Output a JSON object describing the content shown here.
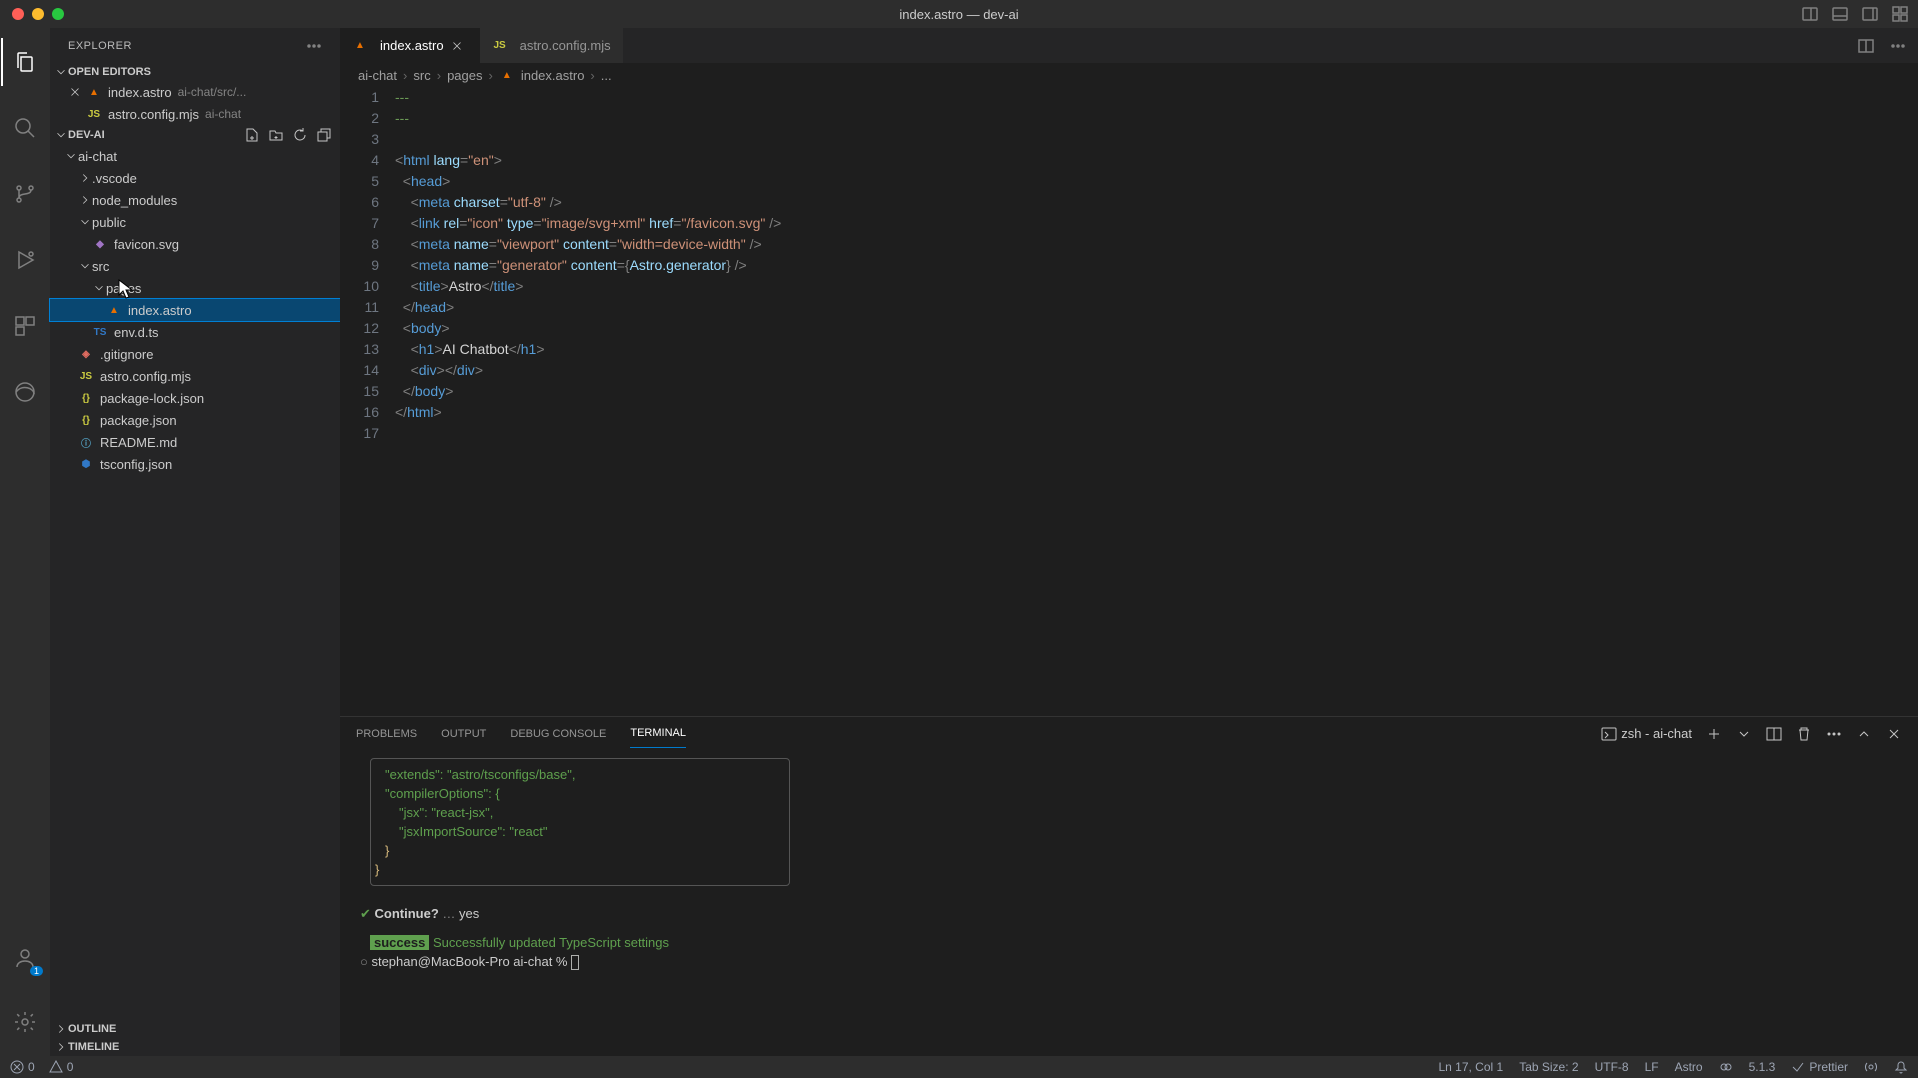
{
  "window": {
    "title": "index.astro — dev-ai"
  },
  "explorer": {
    "title": "EXPLORER",
    "openEditors": {
      "label": "OPEN EDITORS",
      "items": [
        {
          "name": "index.astro",
          "hint": "ai-chat/src/..."
        },
        {
          "name": "astro.config.mjs",
          "hint": "ai-chat"
        }
      ]
    },
    "workspace": {
      "name": "DEV-AI",
      "tree": {
        "aiChat": "ai-chat",
        "vscode": ".vscode",
        "nodeModules": "node_modules",
        "public": "public",
        "favicon": "favicon.svg",
        "src": "src",
        "pages": "pages",
        "indexAstro": "index.astro",
        "envDts": "env.d.ts",
        "gitignore": ".gitignore",
        "astroConfig": "astro.config.mjs",
        "packageLock": "package-lock.json",
        "packageJson": "package.json",
        "readme": "README.md",
        "tsconfig": "tsconfig.json"
      }
    },
    "outline": "OUTLINE",
    "timeline": "TIMELINE"
  },
  "tabs": [
    {
      "name": "index.astro",
      "active": true
    },
    {
      "name": "astro.config.mjs",
      "active": false
    }
  ],
  "breadcrumbs": [
    "ai-chat",
    "src",
    "pages",
    "index.astro",
    "..."
  ],
  "code": {
    "lines": [
      {
        "n": 1,
        "html": "<span class='tok-comment'>---</span>"
      },
      {
        "n": 2,
        "html": "<span class='tok-comment'>---</span>"
      },
      {
        "n": 3,
        "html": ""
      },
      {
        "n": 4,
        "html": "<span class='tok-punc'>&lt;</span><span class='tok-tag'>html</span> <span class='tok-attr'>lang</span><span class='tok-punc'>=</span><span class='tok-str'>\"en\"</span><span class='tok-punc'>&gt;</span>"
      },
      {
        "n": 5,
        "html": "  <span class='tok-punc'>&lt;</span><span class='tok-tag'>head</span><span class='tok-punc'>&gt;</span>"
      },
      {
        "n": 6,
        "html": "    <span class='tok-punc'>&lt;</span><span class='tok-tag'>meta</span> <span class='tok-attr'>charset</span><span class='tok-punc'>=</span><span class='tok-str'>\"utf-8\"</span> <span class='tok-punc'>/&gt;</span>"
      },
      {
        "n": 7,
        "html": "    <span class='tok-punc'>&lt;</span><span class='tok-tag'>link</span> <span class='tok-attr'>rel</span><span class='tok-punc'>=</span><span class='tok-str'>\"icon\"</span> <span class='tok-attr'>type</span><span class='tok-punc'>=</span><span class='tok-str'>\"image/svg+xml\"</span> <span class='tok-attr'>href</span><span class='tok-punc'>=</span><span class='tok-str'>\"/favicon.svg\"</span> <span class='tok-punc'>/&gt;</span>"
      },
      {
        "n": 8,
        "html": "    <span class='tok-punc'>&lt;</span><span class='tok-tag'>meta</span> <span class='tok-attr'>name</span><span class='tok-punc'>=</span><span class='tok-str'>\"viewport\"</span> <span class='tok-attr'>content</span><span class='tok-punc'>=</span><span class='tok-str'>\"width=device-width\"</span> <span class='tok-punc'>/&gt;</span>"
      },
      {
        "n": 9,
        "html": "    <span class='tok-punc'>&lt;</span><span class='tok-tag'>meta</span> <span class='tok-attr'>name</span><span class='tok-punc'>=</span><span class='tok-str'>\"generator\"</span> <span class='tok-attr'>content</span><span class='tok-punc'>=</span><span class='tok-punc'>{</span><span class='tok-expr'>Astro.generator</span><span class='tok-punc'>}</span> <span class='tok-punc'>/&gt;</span>"
      },
      {
        "n": 10,
        "html": "    <span class='tok-punc'>&lt;</span><span class='tok-tag'>title</span><span class='tok-punc'>&gt;</span><span class='tok-text'>Astro</span><span class='tok-punc'>&lt;/</span><span class='tok-tag'>title</span><span class='tok-punc'>&gt;</span>"
      },
      {
        "n": 11,
        "html": "  <span class='tok-punc'>&lt;/</span><span class='tok-tag'>head</span><span class='tok-punc'>&gt;</span>"
      },
      {
        "n": 12,
        "html": "  <span class='tok-punc'>&lt;</span><span class='tok-tag'>body</span><span class='tok-punc'>&gt;</span>"
      },
      {
        "n": 13,
        "html": "    <span class='tok-punc'>&lt;</span><span class='tok-tag'>h1</span><span class='tok-punc'>&gt;</span><span class='tok-text'>AI Chatbot</span><span class='tok-punc'>&lt;/</span><span class='tok-tag'>h1</span><span class='tok-punc'>&gt;</span>"
      },
      {
        "n": 14,
        "html": "    <span class='tok-punc'>&lt;</span><span class='tok-tag'>div</span><span class='tok-punc'>&gt;&lt;/</span><span class='tok-tag'>div</span><span class='tok-punc'>&gt;</span>"
      },
      {
        "n": 15,
        "html": "  <span class='tok-punc'>&lt;/</span><span class='tok-tag'>body</span><span class='tok-punc'>&gt;</span>"
      },
      {
        "n": 16,
        "html": "<span class='tok-punc'>&lt;/</span><span class='tok-tag'>html</span><span class='tok-punc'>&gt;</span>"
      },
      {
        "n": 17,
        "html": ""
      }
    ]
  },
  "panel": {
    "tabs": {
      "problems": "PROBLEMS",
      "output": "OUTPUT",
      "debug": "DEBUG CONSOLE",
      "terminal": "TERMINAL"
    },
    "termLabel": "zsh - ai-chat",
    "terminal": {
      "json": {
        "l1": "\"extends\": \"astro/tsconfigs/base\",",
        "l2": "\"compilerOptions\": {",
        "l3": "\"jsx\": \"react-jsx\",",
        "l4": "\"jsxImportSource\": \"react\"",
        "l5": "}",
        "l6": "}"
      },
      "continuePrompt": "Continue?",
      "continueAnswer": "yes",
      "successLabel": "success",
      "successMsg": "Successfully updated TypeScript settings",
      "prompt": "stephan@MacBook-Pro ai-chat % "
    }
  },
  "statusbar": {
    "errors": "0",
    "warnings": "0",
    "position": "Ln 17, Col 1",
    "tabSize": "Tab Size: 2",
    "encoding": "UTF-8",
    "eol": "LF",
    "language": "Astro",
    "version": "5.1.3",
    "prettier": "Prettier"
  }
}
